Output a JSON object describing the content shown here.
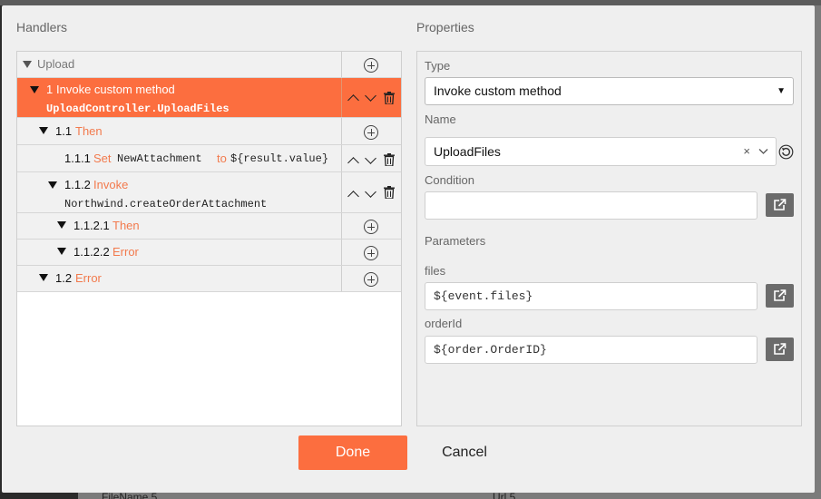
{
  "background": {
    "footer_left": "FileName 5",
    "footer_right": "Url 5"
  },
  "dialog": {
    "handlers_title": "Handlers",
    "properties_title": "Properties"
  },
  "handlers": {
    "root": {
      "label": "Upload"
    },
    "item1": {
      "num": "1",
      "label": "Invoke custom method",
      "code": "UploadController.UploadFiles"
    },
    "item11": {
      "num": "1.1",
      "label": "Then"
    },
    "item111": {
      "num": "1.1.1",
      "kw_set": "Set",
      "target": "NewAttachment",
      "kw_to": "to",
      "value": "${result.value}"
    },
    "item112": {
      "num": "1.1.2",
      "label": "Invoke",
      "code": "Northwind.createOrderAttachment"
    },
    "item1121": {
      "num": "1.1.2.1",
      "label": "Then"
    },
    "item1122": {
      "num": "1.1.2.2",
      "label": "Error"
    },
    "item12": {
      "num": "1.2",
      "label": "Error"
    }
  },
  "properties": {
    "type_label": "Type",
    "type_value": "Invoke custom method",
    "name_label": "Name",
    "name_value": "UploadFiles",
    "name_clear": "×",
    "condition_label": "Condition",
    "condition_value": "",
    "parameters_label": "Parameters",
    "files_label": "files",
    "files_value": "${event.files}",
    "orderid_label": "orderId",
    "orderid_value": "${order.OrderID}"
  },
  "buttons": {
    "done": "Done",
    "cancel": "Cancel"
  },
  "colors": {
    "accent": "#fc6e3f",
    "keyword": "#f27a4d",
    "icon_button": "#6b6b6b"
  }
}
